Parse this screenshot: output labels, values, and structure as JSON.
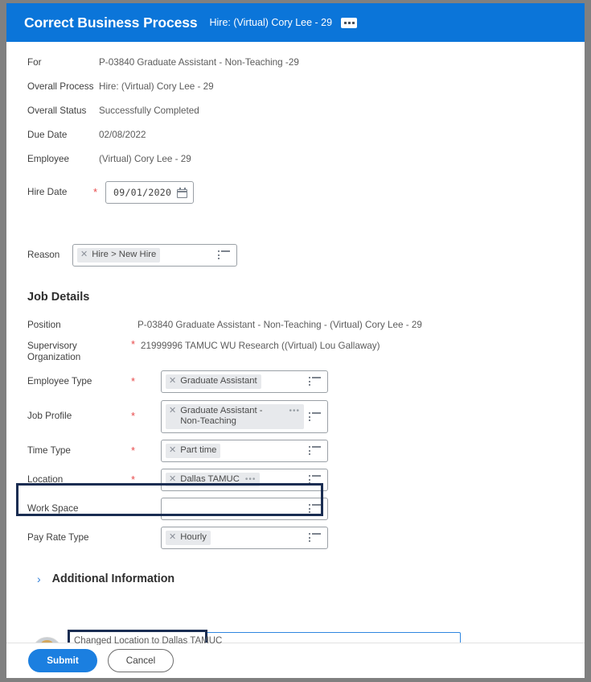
{
  "header": {
    "title": "Correct Business Process",
    "subtitle": "Hire: (Virtual) Cory Lee - 29",
    "menu_icon": "ellipsis-menu-icon"
  },
  "summary": {
    "rows": [
      {
        "label": "For",
        "value": "P-03840 Graduate Assistant - Non-Teaching -29",
        "required": false
      },
      {
        "label": "Overall Process",
        "value": "Hire: (Virtual) Cory Lee - 29",
        "required": false
      },
      {
        "label": "Overall Status",
        "value": "Successfully Completed",
        "required": false
      },
      {
        "label": "Due Date",
        "value": "02/08/2022",
        "required": false
      },
      {
        "label": "Employee",
        "value": "(Virtual) Cory Lee - 29",
        "required": false
      }
    ],
    "hire_date": {
      "label": "Hire Date",
      "value": "09/01/2020",
      "required": true,
      "icon": "calendar-icon"
    }
  },
  "reason": {
    "label": "Reason",
    "required": false,
    "pill": "Hire > New Hire",
    "remove_icon": "remove-x-icon",
    "list_icon": "list-prompt-icon"
  },
  "job_details": {
    "heading": "Job Details",
    "position": {
      "label": "Position",
      "value": "P-03840 Graduate Assistant - Non-Teaching - (Virtual) Cory Lee - 29",
      "required": false
    },
    "supervisory_organization": {
      "label": "Supervisory Organization",
      "value": "21999996 TAMUC WU Research ((Virtual) Lou Gallaway)",
      "required": true
    },
    "fields": [
      {
        "label": "Employee Type",
        "required": true,
        "pill": "Graduate Assistant",
        "overflow": "",
        "empty": false
      },
      {
        "label": "Job Profile",
        "required": true,
        "pill": "Graduate Assistant - Non-Teaching",
        "overflow": "•••",
        "empty": false
      },
      {
        "label": "Time Type",
        "required": true,
        "pill": "Part time",
        "overflow": "",
        "empty": false
      },
      {
        "label": "Location",
        "required": true,
        "pill": "Dallas TAMUC",
        "overflow": "•••",
        "empty": false
      },
      {
        "label": "Work Space",
        "required": false,
        "pill": "",
        "overflow": "",
        "empty": true
      },
      {
        "label": "Pay Rate Type",
        "required": false,
        "pill": "Hourly",
        "overflow": "",
        "empty": false
      }
    ]
  },
  "additional_information": {
    "label": "Additional Information",
    "chevron": "›",
    "expanded": false
  },
  "comment": {
    "value": "Changed Location to Dallas TAMUC",
    "avatar": "user-avatar"
  },
  "footer": {
    "submit_label": "Submit",
    "cancel_label": "Cancel"
  },
  "colors": {
    "header_blue": "#0b75d9",
    "accent_blue": "#1b7fe0",
    "highlight_navy": "#1a2d52",
    "required_red": "#e8494a",
    "pill_gray": "#e7e9ec"
  }
}
